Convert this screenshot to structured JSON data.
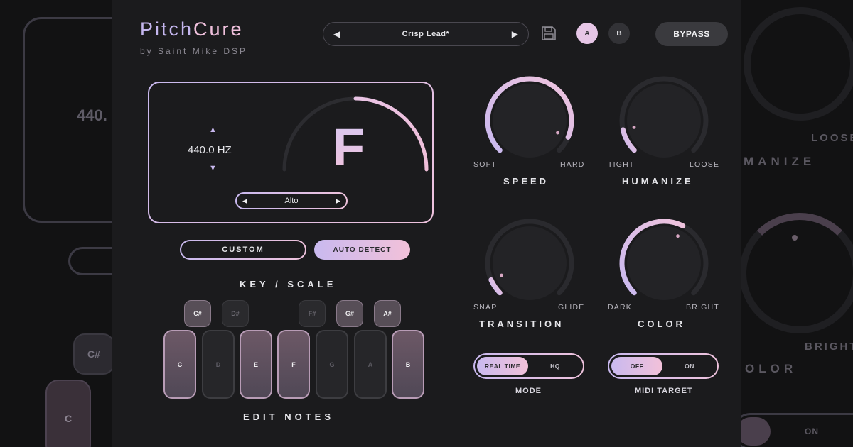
{
  "background": {
    "freq": "440.",
    "csharp": "C#",
    "c": "C",
    "loose": "LOOSE",
    "humanize": "MANIZE",
    "bright": "BRIGHT",
    "color": "OLOR",
    "on": "ON"
  },
  "brand": {
    "title_part1": "Pitch",
    "title_part2": "Cure",
    "subtitle": "by Saint Mike DSP"
  },
  "header": {
    "preset": {
      "prev": "◀",
      "name": "Crisp Lead*",
      "next": "▶"
    },
    "slot_a": "A",
    "slot_b": "B",
    "bypass": "BYPASS"
  },
  "display": {
    "freq_up": "▲",
    "frequency": "440.0 HZ",
    "freq_down": "▼",
    "note": "F",
    "voice": {
      "prev": "◀",
      "name": "Alto",
      "next": "▶"
    }
  },
  "mode_buttons": {
    "custom": "CUSTOM",
    "auto_detect": "AUTO DETECT"
  },
  "keyscale": {
    "title": "KEY / SCALE",
    "black_keys": [
      {
        "label": "C#",
        "active": true
      },
      {
        "label": "D#",
        "active": false
      },
      {
        "label": "F#",
        "active": false
      },
      {
        "label": "G#",
        "active": true
      },
      {
        "label": "A#",
        "active": true
      }
    ],
    "white_keys": [
      {
        "label": "C",
        "active": true
      },
      {
        "label": "D",
        "active": false
      },
      {
        "label": "E",
        "active": true
      },
      {
        "label": "F",
        "active": true
      },
      {
        "label": "G",
        "active": false
      },
      {
        "label": "A",
        "active": false
      },
      {
        "label": "B",
        "active": true
      }
    ],
    "footer": "EDIT NOTES"
  },
  "knobs": {
    "speed": {
      "title": "SPEED",
      "min": "SOFT",
      "max": "HARD",
      "value": 0.92
    },
    "humanize": {
      "title": "HUMANIZE",
      "min": "TIGHT",
      "max": "LOOSE",
      "value": 0.12
    },
    "transition": {
      "title": "TRANSITION",
      "min": "SNAP",
      "max": "GLIDE",
      "value": 0.08
    },
    "color": {
      "title": "COLOR",
      "min": "DARK",
      "max": "BRIGHT",
      "value": 0.6
    }
  },
  "toggles": {
    "mode": {
      "label": "MODE",
      "options": [
        "REAL TIME",
        "HQ"
      ],
      "selected": "REAL TIME"
    },
    "midi_target": {
      "label": "MIDI TARGET",
      "options": [
        "OFF",
        "ON"
      ],
      "selected": "OFF"
    }
  },
  "colors": {
    "accent_start": "#c9b9ef",
    "accent_end": "#efc3dd",
    "panel": "#1b1b1d"
  }
}
